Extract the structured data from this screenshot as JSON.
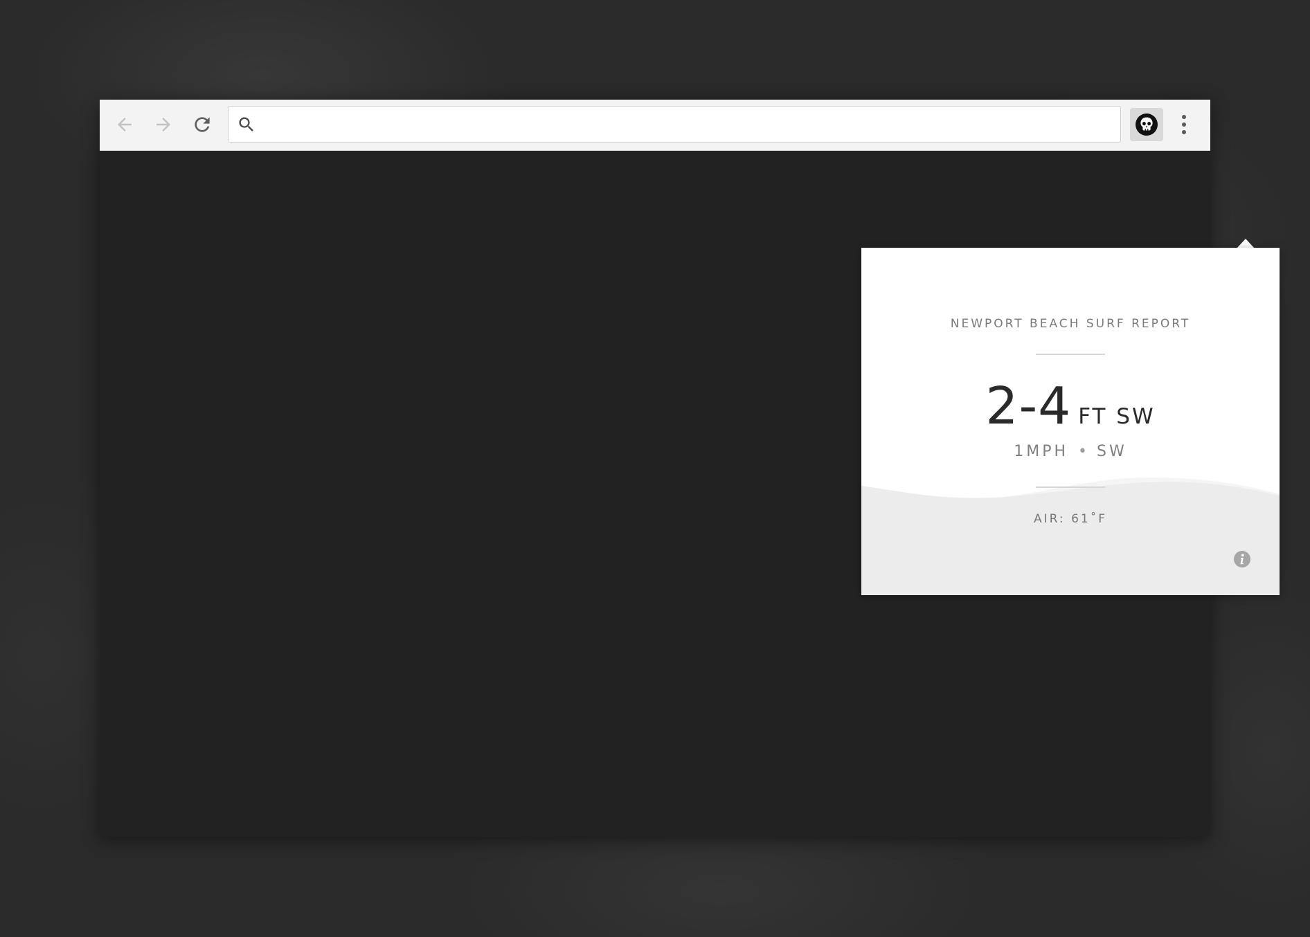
{
  "browser": {
    "toolbar": {
      "back_icon": "arrow-left-icon",
      "forward_icon": "arrow-right-icon",
      "reload_icon": "reload-icon",
      "search_icon": "search-icon",
      "address_value": "",
      "extension_icon": "skull-icon",
      "menu_icon": "vertical-dots-icon"
    }
  },
  "popup": {
    "title": "NEWPORT BEACH SURF REPORT",
    "wave_height": "2-4",
    "wave_unit": "FT SW",
    "wind_speed": "1MPH",
    "wind_separator": "•",
    "wind_direction": "SW",
    "air_temp": "AIR: 61˚F",
    "info_icon": "info-icon"
  },
  "colors": {
    "toolbar_bg": "#f3f3f3",
    "page_bg": "#222222",
    "popup_bg": "#ffffff",
    "wave_fill": "#ececec",
    "text_dark": "#2a2a2a",
    "text_muted": "#7a7a7a"
  }
}
